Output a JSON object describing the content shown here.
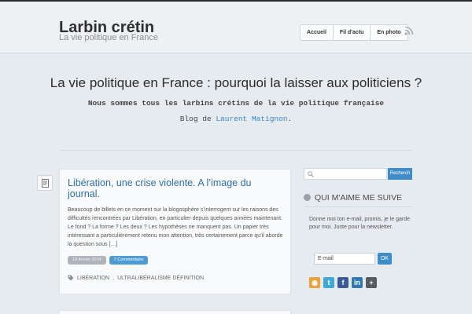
{
  "header": {
    "title": "Larbin crétin",
    "tagline": "La vie politique en France",
    "nav": [
      "Accueil",
      "Fil d'actu",
      "En photo"
    ],
    "rss_icon": "rss-icon"
  },
  "hero": {
    "title": "La vie politique en France : pourquoi la laisser aux politiciens ?",
    "subtitle": "Nous sommes tous les larbins crétins de la vie politique française",
    "byline_prefix": "Blog de",
    "byline_author": "Laurent Matignon",
    "byline_suffix": "."
  },
  "post": {
    "type_icon": "document-icon",
    "title": "Libération, une crise violente. A l’image du journal.",
    "excerpt": "Beaucoup de billets en ce moment sur la blogosphère s’interrogent sur les raisons des difficultés rencontrées par Libération, en particulier depuis quelques années maintenant. Le fond ? La forme ? Les deux ? Les hypothèses ne manquent pas. Un papier très intéressant a particulièrement retenu mon attention, très certainement parce qu’il aborde la question sous […]",
    "date": "18 février 2014",
    "comments": "7 Commentaire",
    "tags": [
      "LIBÉRATION",
      "ULTRALIBÉRALISME DÉFINITION"
    ]
  },
  "sidebar": {
    "search_button": "Recherch",
    "widget_title": "QUI M'AIME ME SUIVE",
    "widget_text": "Donne moi ton e-mail, promis, je le garde pour moi. Juste pour la newsletter.",
    "email_value": "E-mail",
    "ok_label": "OK",
    "social": [
      {
        "name": "rss-icon",
        "color": "#e8a33d",
        "glyph": "◉"
      },
      {
        "name": "twitter-icon",
        "color": "#3fa9d8",
        "glyph": "t"
      },
      {
        "name": "facebook-icon",
        "color": "#3b5b98",
        "glyph": "f"
      },
      {
        "name": "linkedin-icon",
        "color": "#2f7ab3",
        "glyph": "in"
      },
      {
        "name": "google-plus-icon",
        "color": "#555b60",
        "glyph": "+"
      }
    ]
  },
  "colors": {
    "accent": "#3f8cc9",
    "link": "#2f6fa5"
  }
}
